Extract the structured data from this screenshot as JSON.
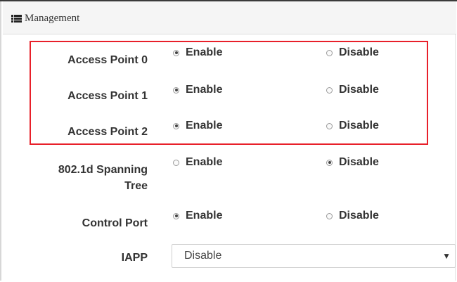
{
  "panel": {
    "title": "Management",
    "icon": "list-icon"
  },
  "rows": [
    {
      "label": "Access Point 0",
      "options": [
        {
          "label": "Enable",
          "checked": true
        },
        {
          "label": "Disable",
          "checked": false
        }
      ]
    },
    {
      "label": "Access Point 1",
      "options": [
        {
          "label": "Enable",
          "checked": true
        },
        {
          "label": "Disable",
          "checked": false
        }
      ]
    },
    {
      "label": "Access Point 2",
      "options": [
        {
          "label": "Enable",
          "checked": true
        },
        {
          "label": "Disable",
          "checked": false
        }
      ]
    },
    {
      "label_line1": "802.1d Spanning",
      "label_line2": "Tree",
      "options": [
        {
          "label": "Enable",
          "checked": false
        },
        {
          "label": "Disable",
          "checked": true
        }
      ]
    },
    {
      "label": "Control Port",
      "options": [
        {
          "label": "Enable",
          "checked": true
        },
        {
          "label": "Disable",
          "checked": false
        }
      ]
    }
  ],
  "iapp": {
    "label": "IAPP",
    "selected": "Disable",
    "arrow_icon": "caret-down-icon"
  },
  "colors": {
    "highlight": "#e8202a",
    "text": "#333333",
    "header_bg": "#f5f5f5"
  }
}
